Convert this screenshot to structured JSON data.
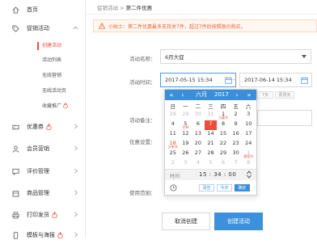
{
  "sidebar": {
    "home": "首页",
    "promo": "促销活动",
    "promo_sub": [
      "创建活动",
      "活动列表",
      "无线营销",
      "无线活动页",
      "收藏推广"
    ],
    "coupon": "优惠券",
    "member": "会员营销",
    "review": "评价管理",
    "goods": "商品管理",
    "print": "打印发货",
    "mobile": "模板与海报"
  },
  "breadcrumb": {
    "parent": "促销活动",
    "sep": " > ",
    "current": "第二件优惠"
  },
  "notice": "小贴士：第二件优惠最多支持关7件，超过7件后按照原价购买。",
  "form": {
    "name_label": "活动名称：",
    "name_value": "6月大促",
    "time_label": "活动时间：",
    "start_time": "2017-05-15 15:34",
    "end_time": "2017-06-14 15:34",
    "dash": "-",
    "remark_label": "活动备注：",
    "discount_label": "优惠设置：",
    "scope_label": "使用范围：",
    "hidden_btn1": "当前",
    "hidden_btn2": "7天",
    "hidden_btn3": "更改天"
  },
  "picker": {
    "prev_year": "«",
    "prev_month": "‹",
    "month": "六月",
    "year": "2017",
    "next_month": "›",
    "next_year": "»",
    "weekdays": [
      "日",
      "一",
      "二",
      "三",
      "四",
      "五",
      "六"
    ],
    "rows": [
      [
        {
          "d": "28",
          "m": true
        },
        {
          "d": "29",
          "m": true
        },
        {
          "d": "30",
          "m": true
        },
        {
          "d": "31",
          "m": true
        },
        {
          "d": "1",
          "h": "儿童节"
        },
        {
          "d": "2"
        },
        {
          "d": "3"
        }
      ],
      [
        {
          "d": "4"
        },
        {
          "d": "5",
          "h": "芒种"
        },
        {
          "d": "6"
        },
        {
          "d": "7",
          "sel": true
        },
        {
          "d": "8"
        },
        {
          "d": "9"
        },
        {
          "d": "10"
        }
      ],
      [
        {
          "d": "11"
        },
        {
          "d": "12"
        },
        {
          "d": "13"
        },
        {
          "d": "14"
        },
        {
          "d": "15"
        },
        {
          "d": "16"
        },
        {
          "d": "17"
        }
      ],
      [
        {
          "d": "18",
          "h": "父亲节",
          "red": true
        },
        {
          "d": "19"
        },
        {
          "d": "20"
        },
        {
          "d": "21"
        },
        {
          "d": "22"
        },
        {
          "d": "23"
        },
        {
          "d": "24"
        }
      ],
      [
        {
          "d": "25"
        },
        {
          "d": "26"
        },
        {
          "d": "27"
        },
        {
          "d": "28"
        },
        {
          "d": "29"
        },
        {
          "d": "30"
        },
        {
          "d": "1",
          "m": true,
          "h": "建党节"
        }
      ],
      [
        {
          "d": "2",
          "m": true
        },
        {
          "d": "3",
          "m": true
        },
        {
          "d": "4",
          "m": true
        },
        {
          "d": "5",
          "m": true
        },
        {
          "d": "6",
          "m": true
        },
        {
          "d": "7",
          "m": true
        },
        {
          "d": "8",
          "m": true
        }
      ]
    ],
    "time_label": "时间",
    "time_value": "15 : 34 : 00",
    "btn_clear": "清空",
    "btn_today": "今天",
    "btn_ok": "确定"
  },
  "buttons": {
    "cancel": "取消创建",
    "create": "创建活动"
  },
  "colors": {
    "accent": "#3b8fd9",
    "red": "#e94e3c"
  }
}
